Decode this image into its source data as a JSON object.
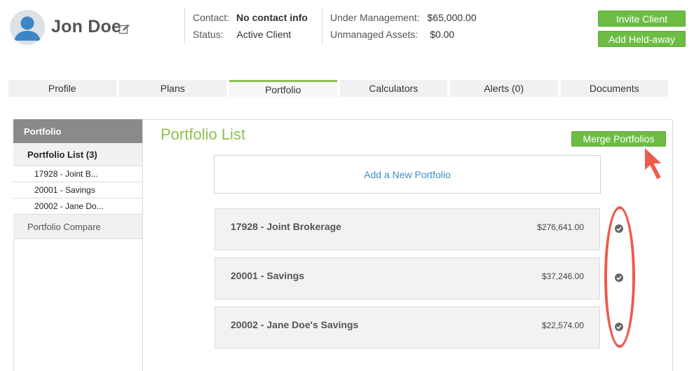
{
  "header": {
    "client_name": "Jon Doe",
    "contact_label": "Contact:",
    "contact_value": "No contact info",
    "status_label": "Status:",
    "status_value": "Active Client",
    "under_mgmt_label": "Under Management:",
    "under_mgmt_value": "$65,000.00",
    "unmanaged_label": "Unmanaged Assets:",
    "unmanaged_value": "$0.00",
    "invite_button": "Invite Client",
    "heldaway_button": "Add Held-away"
  },
  "tabs": [
    {
      "label": "Profile"
    },
    {
      "label": "Plans"
    },
    {
      "label": "Portfolio",
      "active": true
    },
    {
      "label": "Calculators"
    },
    {
      "label": "Alerts (0)"
    },
    {
      "label": "Documents"
    }
  ],
  "sidebar": {
    "header": "Portfolio",
    "list_label": "Portfolio List (3)",
    "sub_items": [
      "17928 - Joint B...",
      "20001 - Savings",
      "20002 - Jane Do..."
    ],
    "compare_label": "Portfolio Compare"
  },
  "main": {
    "title": "Portfolio List",
    "merge_button": "Merge Portfolios",
    "add_portfolio": "Add a New Portfolio",
    "portfolios": [
      {
        "name": "17928 - Joint Brokerage",
        "value": "$276,641.00"
      },
      {
        "name": "20001 - Savings",
        "value": "$37,246.00"
      },
      {
        "name": "20002 - Jane Doe's Savings",
        "value": "$22,574.00"
      }
    ]
  },
  "icons": {
    "avatar": "user-avatar-icon",
    "edit": "edit-icon",
    "check": "check-circle-icon",
    "arrow": "pointer-arrow-icon"
  },
  "colors": {
    "accent_green": "#6dbd45",
    "title_green": "#8cc152",
    "link_blue": "#3a8fc9",
    "annotation_red": "#ee5b4d"
  }
}
